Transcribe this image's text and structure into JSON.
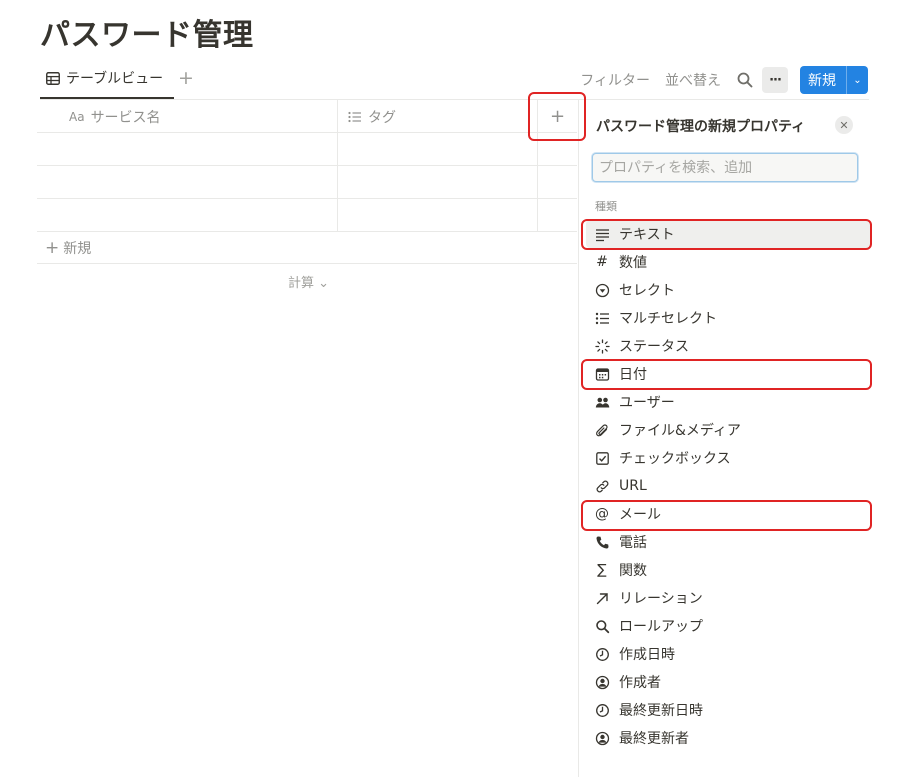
{
  "page": {
    "title": "パスワード管理"
  },
  "toolbar": {
    "view_tab_label": "テーブルビュー",
    "add_view": "+",
    "filter_label": "フィルター",
    "sort_label": "並べ替え",
    "more_label": "···",
    "new_label": "新規",
    "new_chevron": "⌄"
  },
  "table": {
    "columns": [
      {
        "icon": "Aa",
        "label": "サービス名"
      },
      {
        "icon": "list-icon",
        "label": "タグ"
      }
    ],
    "add_column": "+",
    "new_row_plus": "+",
    "new_row_label": "新規",
    "calc_label": "計算 ⌄"
  },
  "panel": {
    "title": "パスワード管理の新規プロパティ",
    "close": "✕",
    "search_placeholder": "プロパティを検索、追加",
    "section_label": "種類",
    "types": [
      {
        "label": "テキスト",
        "icon": "text-lines-icon"
      },
      {
        "label": "数値",
        "icon": "hash-icon"
      },
      {
        "label": "セレクト",
        "icon": "select-circle-icon"
      },
      {
        "label": "マルチセレクト",
        "icon": "list-icon"
      },
      {
        "label": "ステータス",
        "icon": "status-icon"
      },
      {
        "label": "日付",
        "icon": "calendar-icon"
      },
      {
        "label": "ユーザー",
        "icon": "users-icon"
      },
      {
        "label": "ファイル&メディア",
        "icon": "paperclip-icon"
      },
      {
        "label": "チェックボックス",
        "icon": "checkbox-icon"
      },
      {
        "label": "URL",
        "icon": "link-icon"
      },
      {
        "label": "メール",
        "icon": "at-icon"
      },
      {
        "label": "電話",
        "icon": "phone-icon"
      },
      {
        "label": "関数",
        "icon": "sigma-icon"
      },
      {
        "label": "リレーション",
        "icon": "arrow-up-right-icon"
      },
      {
        "label": "ロールアップ",
        "icon": "search-icon"
      },
      {
        "label": "作成日時",
        "icon": "clock-icon"
      },
      {
        "label": "作成者",
        "icon": "user-circle-icon"
      },
      {
        "label": "最終更新日時",
        "icon": "clock-icon"
      },
      {
        "label": "最終更新者",
        "icon": "user-circle-icon"
      }
    ]
  },
  "colors": {
    "accent": "#2383e2",
    "highlight": "#e02424",
    "text": "#37352f"
  }
}
